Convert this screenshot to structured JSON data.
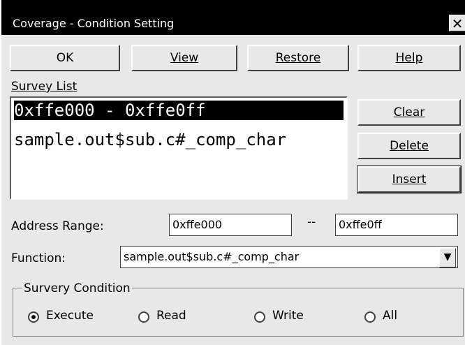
{
  "window": {
    "title": "Coverage - Condition Setting",
    "close_label": "✕"
  },
  "buttons": {
    "ok": "OK",
    "view": "View",
    "restore": "Restore",
    "help": "Help",
    "clear": "Clear",
    "delete": "Delete",
    "insert": "Insert"
  },
  "survey_list": {
    "label": "Survey List",
    "items": [
      "0xffe000 - 0xffe0ff",
      "sample.out$sub.c#_comp_char"
    ],
    "selected_index": 0
  },
  "address_range": {
    "label": "Address Range:",
    "from": "0xffe000",
    "separator": "--",
    "to": "0xffe0ff"
  },
  "function": {
    "label": "Function:",
    "value": "sample.out$sub.c#_comp_char"
  },
  "condition": {
    "title": "Survery Condition",
    "options": [
      "Execute",
      "Read",
      "Write",
      "All"
    ],
    "selected": "Execute"
  }
}
